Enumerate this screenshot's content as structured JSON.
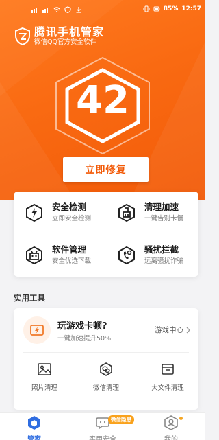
{
  "status_bar": {
    "battery": "85%",
    "time": "12:57"
  },
  "brand": {
    "title": "腾讯手机管家",
    "subtitle": "微信QQ官方安全软件"
  },
  "score": {
    "value": "42"
  },
  "fix_button": {
    "label": "立即修复"
  },
  "features": [
    {
      "title": "安全检测",
      "subtitle": "立即安全检测",
      "icon": "lightning-shield-icon"
    },
    {
      "title": "清理加速",
      "subtitle": "一键告别卡慢",
      "icon": "broom-icon"
    },
    {
      "title": "软件管理",
      "subtitle": "安全优选下载",
      "icon": "robot-box-icon"
    },
    {
      "title": "骚扰拦截",
      "subtitle": "远离骚扰诈骗",
      "icon": "phone-block-icon"
    }
  ],
  "tools_section": {
    "title": "实用工具",
    "game": {
      "title": "玩游戏卡顿?",
      "subtitle": "一键加速提升50%",
      "link": "游戏中心"
    },
    "items": [
      {
        "label": "照片清理",
        "icon": "photo-icon"
      },
      {
        "label": "微信清理",
        "icon": "wechat-icon"
      },
      {
        "label": "大文件清理",
        "icon": "file-box-icon"
      }
    ]
  },
  "bottom_nav": {
    "items": [
      {
        "label": "管家",
        "icon": "home-hex-icon",
        "active": true
      },
      {
        "label": "实用安全",
        "icon": "chat-shield-icon",
        "badge": "微信隐患"
      },
      {
        "label": "我的",
        "icon": "user-icon"
      }
    ]
  },
  "colors": {
    "brand_orange": "#f96a12",
    "accent_blue": "#2f6de1",
    "badge_orange": "#f9a21d"
  }
}
